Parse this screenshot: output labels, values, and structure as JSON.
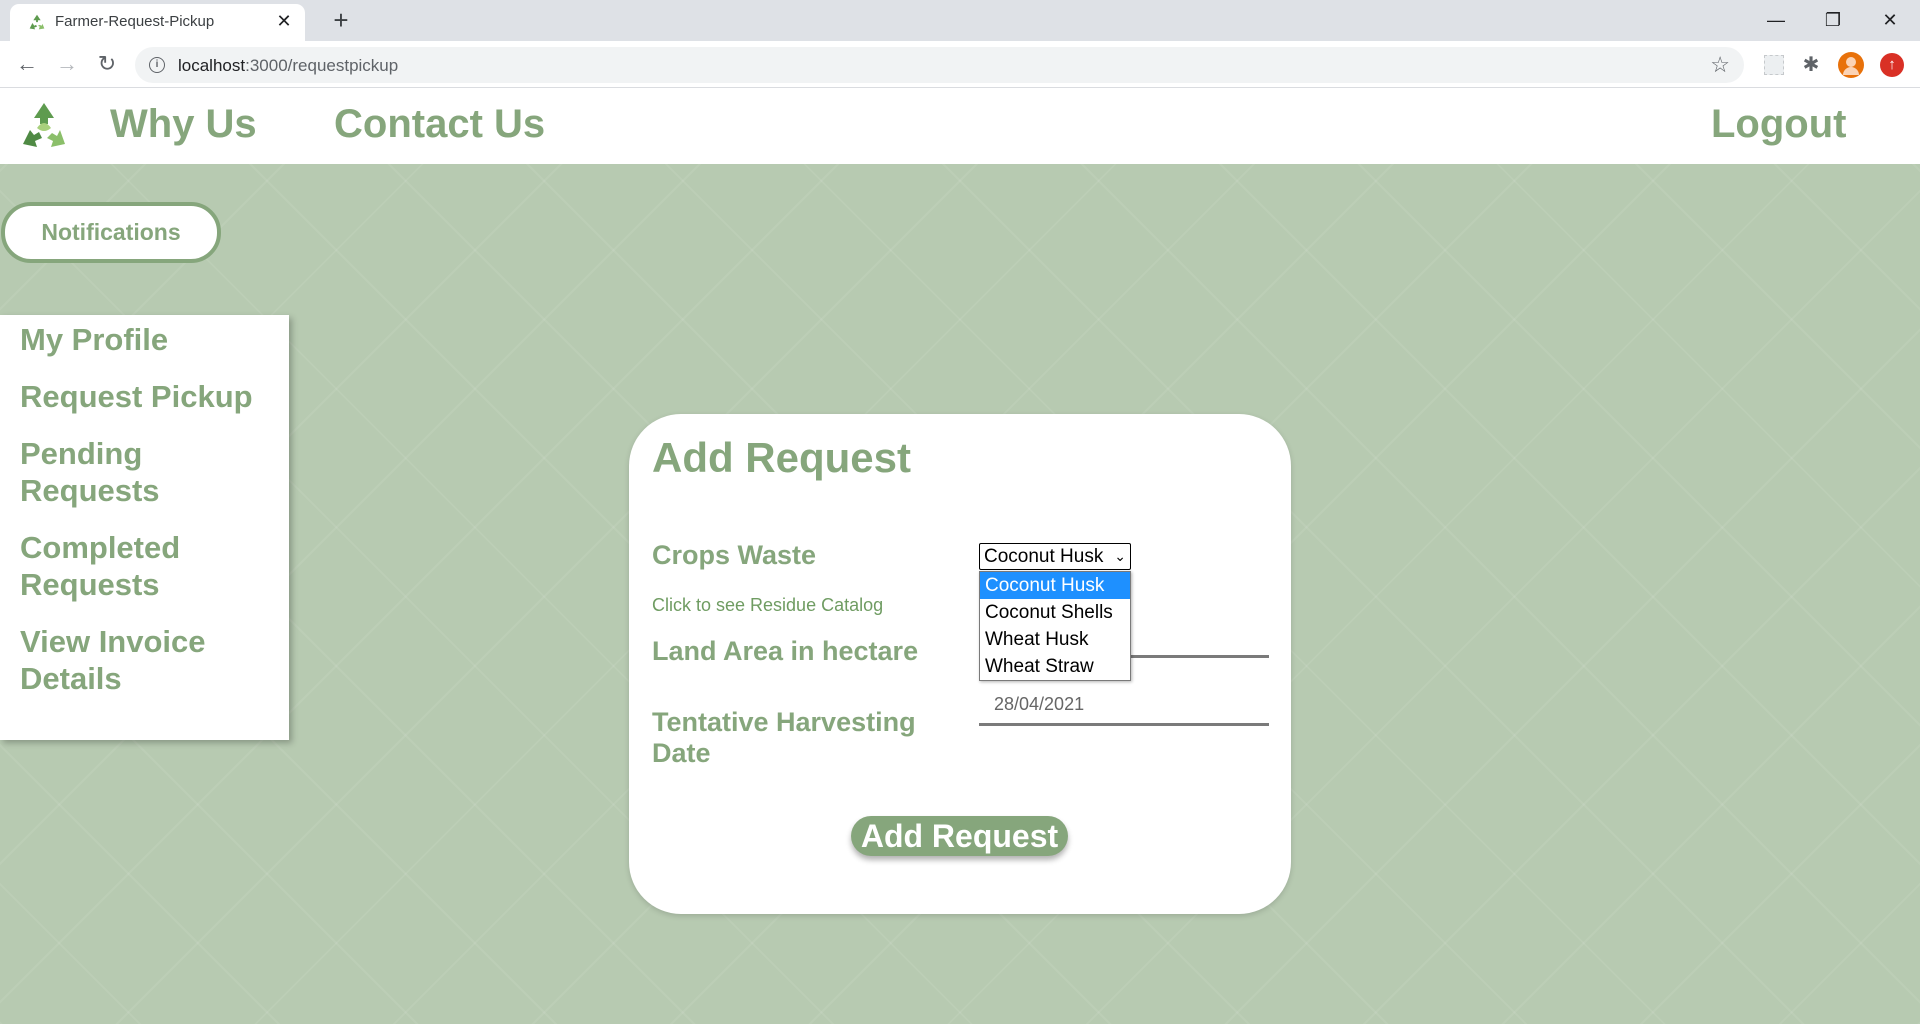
{
  "browser": {
    "tab_title": "Farmer-Request-Pickup",
    "tab_close": "✕",
    "new_tab": "+",
    "url_host": "localhost",
    "url_path": ":3000/requestpickup",
    "controls": {
      "minimize": "—",
      "restore": "❐",
      "close": "✕"
    }
  },
  "header": {
    "links": [
      "Why Us",
      "Contact Us"
    ],
    "logout": "Logout"
  },
  "notifications_label": "Notifications",
  "sidebar": {
    "items": [
      "My Profile",
      "Request Pickup",
      "Pending Requests",
      "Completed Requests",
      "View Invoice Details"
    ]
  },
  "form": {
    "title": "Add Request",
    "crops_waste_label": "Crops Waste",
    "crops_waste_selected": "Coconut Husk",
    "crops_waste_options": [
      "Coconut Husk",
      "Coconut Shells",
      "Wheat Husk",
      "Wheat Straw"
    ],
    "catalog_link": "Click to see Residue Catalog",
    "land_area_label": "Land Area in hectare",
    "land_area_value": "",
    "harvest_label": "Tentative Harvesting Date",
    "harvest_value": "28/04/2021",
    "submit_label": "Add Request"
  },
  "colors": {
    "brand_green": "#86a67c",
    "page_background": "#b7cab1",
    "highlight_blue": "#1e90ff"
  }
}
